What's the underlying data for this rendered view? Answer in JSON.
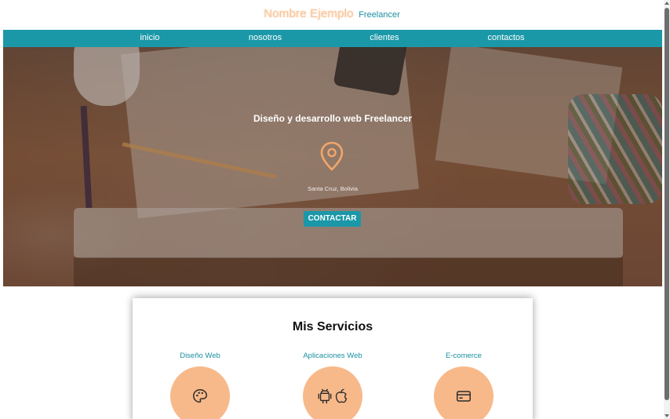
{
  "header": {
    "name": "Nombre Ejemplo",
    "subtitle": "Freelancer"
  },
  "nav": {
    "items": [
      {
        "label": "inicio"
      },
      {
        "label": "nosotros"
      },
      {
        "label": "clientes"
      },
      {
        "label": "contactos"
      }
    ]
  },
  "hero": {
    "title": "Diseño y desarrollo web Freelancer",
    "icon": "location-pin-icon",
    "location": "Santa Cruz, Bolivia",
    "button_label": "CONTACTAR"
  },
  "services": {
    "title": "Mis Servicios",
    "items": [
      {
        "label": "Diseño Web",
        "icon": "palette-icon"
      },
      {
        "label": "Aplicaciones Web",
        "icon": "android-apple-icon"
      },
      {
        "label": "E-comerce",
        "icon": "credit-card-icon"
      }
    ]
  },
  "colors": {
    "accent": "#1b98a8",
    "highlight": "#f8b98a",
    "logo": "#f7c79c"
  }
}
